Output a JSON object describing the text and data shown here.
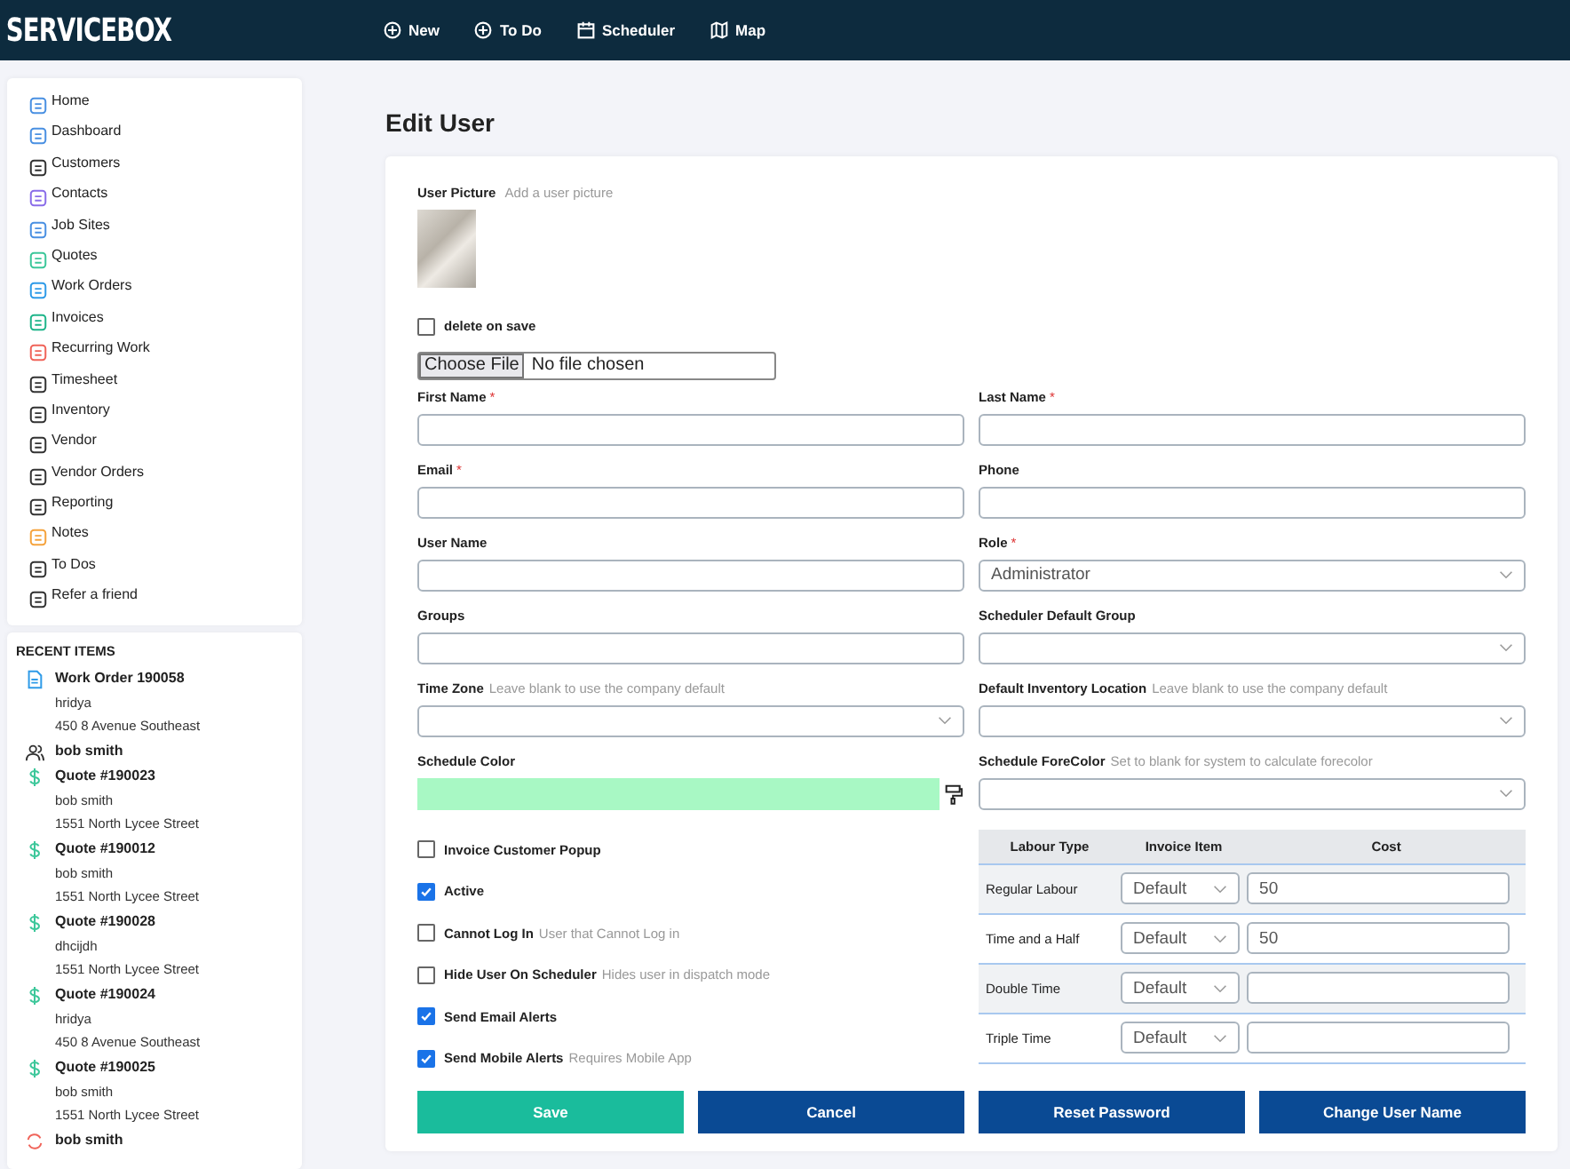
{
  "header": {
    "logo": "SERVICEBOX",
    "nav": [
      {
        "label": "New",
        "kind": "plus"
      },
      {
        "label": "To Do",
        "kind": "plus"
      },
      {
        "label": "Scheduler",
        "kind": "calendar"
      },
      {
        "label": "Map",
        "kind": "map"
      }
    ]
  },
  "sidebar": {
    "items": [
      {
        "label": "Home"
      },
      {
        "label": "Dashboard"
      },
      {
        "label": "Customers"
      },
      {
        "label": "Contacts"
      },
      {
        "label": "Job Sites"
      },
      {
        "label": "Quotes"
      },
      {
        "label": "Work Orders"
      },
      {
        "label": "Invoices"
      },
      {
        "label": "Recurring Work"
      },
      {
        "label": "Timesheet"
      },
      {
        "label": "Inventory"
      },
      {
        "label": "Vendor"
      },
      {
        "label": "Vendor Orders"
      },
      {
        "label": "Reporting"
      },
      {
        "label": "Notes"
      },
      {
        "label": "To Dos"
      },
      {
        "label": "Refer a friend"
      }
    ],
    "recent_title": "RECENT ITEMS",
    "recent_items": [
      {
        "kind": "work_order",
        "title": "Work Order 190058",
        "lines": [
          "hridya",
          "450 8 Avenue Southeast"
        ]
      },
      {
        "kind": "customer",
        "title": "bob smith"
      },
      {
        "kind": "quote",
        "title": "Quote #190023",
        "lines": [
          "bob smith",
          "1551 North Lycee Street"
        ]
      },
      {
        "kind": "quote",
        "title": "Quote #190012",
        "lines": [
          "bob smith",
          "1551 North Lycee Street"
        ]
      },
      {
        "kind": "quote",
        "title": "Quote #190028",
        "lines": [
          "dhcijdh",
          "1551 North Lycee Street"
        ]
      },
      {
        "kind": "quote",
        "title": "Quote #190024",
        "lines": [
          "hridya",
          "450 8 Avenue Southeast"
        ]
      },
      {
        "kind": "quote",
        "title": "Quote #190025",
        "lines": [
          "bob smith",
          "1551 North Lycee Street"
        ]
      },
      {
        "kind": "recurring",
        "title": "bob smith"
      }
    ]
  },
  "page_title": "Edit User",
  "picture": {
    "label": "User Picture",
    "hint": "Add a user picture",
    "delete_label": "delete on save",
    "delete_checked": false,
    "file_button": "Choose File",
    "file_status": "No file chosen"
  },
  "field_rows": [
    [
      {
        "label": "First Name",
        "required": "*",
        "kind": "text"
      },
      {
        "label": "Last Name",
        "required": "*",
        "kind": "text"
      }
    ],
    [
      {
        "label": "Email",
        "required": "*",
        "kind": "text"
      },
      {
        "label": "Phone",
        "kind": "text"
      }
    ],
    [
      {
        "label": "User Name",
        "kind": "text"
      },
      {
        "label": "Role",
        "required": "*",
        "kind": "select",
        "value": "Administrator"
      }
    ],
    [
      {
        "label": "Groups",
        "kind": "text"
      },
      {
        "label": "Scheduler Default Group",
        "kind": "select"
      }
    ],
    [
      {
        "label": "Time Zone",
        "hint": "Leave blank to use the company default",
        "kind": "select"
      },
      {
        "label": "Default Inventory Location",
        "hint": "Leave blank to use the company default",
        "kind": "select"
      }
    ],
    [
      {
        "label": "Schedule Color",
        "kind": "color",
        "color": "#a8f8c4"
      },
      {
        "label": "Schedule ForeColor",
        "hint": "Set to blank for system to calculate forecolor",
        "kind": "select"
      }
    ]
  ],
  "checkboxes": [
    {
      "label": "Invoice Customer Popup",
      "checked": false
    },
    {
      "label": "Active",
      "checked": true
    },
    {
      "label": "Cannot Log In",
      "hint": "User that Cannot Log in",
      "checked": false
    },
    {
      "label": "Hide User On Scheduler",
      "hint": "Hides user in dispatch mode",
      "checked": false
    },
    {
      "label": "Send Email Alerts",
      "checked": true
    },
    {
      "label": "Send Mobile Alerts",
      "hint": "Requires Mobile App",
      "checked": true
    }
  ],
  "labour_table": {
    "columns": [
      "Labour Type",
      "Invoice Item",
      "Cost"
    ],
    "rows": [
      {
        "type": "Regular Labour",
        "item": "Default",
        "cost": "50"
      },
      {
        "type": "Time and a Half",
        "item": "Default",
        "cost": "50"
      },
      {
        "type": "Double Time",
        "item": "Default"
      },
      {
        "type": "Triple Time",
        "item": "Default"
      }
    ]
  },
  "left_buttons": [
    {
      "label": "Save",
      "kind": "success"
    },
    {
      "label": "Cancel",
      "kind": "primary"
    }
  ],
  "right_buttons": [
    {
      "label": "Reset Password",
      "kind": "primary"
    },
    {
      "label": "Change User Name",
      "kind": "primary"
    }
  ]
}
